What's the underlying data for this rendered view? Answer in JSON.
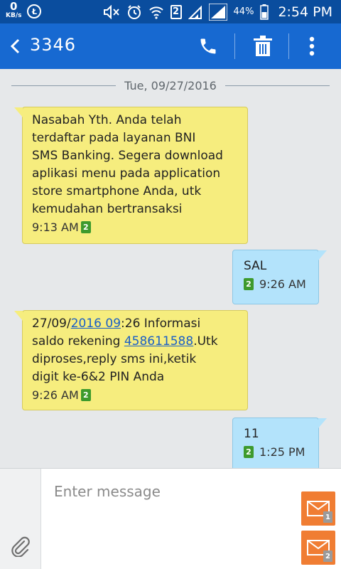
{
  "status_bar": {
    "speed_value": "0",
    "speed_unit": "KB/s",
    "coin_glyph": "Ł",
    "sim_number": "2",
    "battery_percent": "44%",
    "time": "2:54 PM",
    "icons": [
      "data-speed",
      "coin-icon",
      "mute-icon",
      "alarm-icon",
      "wifi-icon",
      "sim-2-icon",
      "signal-icon",
      "signal-icon",
      "battery-icon"
    ]
  },
  "app_bar": {
    "contact": "3346",
    "actions": [
      "call-icon",
      "delete-icon",
      "more-icon"
    ]
  },
  "conversation": {
    "date": "Tue, 09/27/2016",
    "messages": [
      {
        "type": "received",
        "text": "Nasabah Yth. Anda telah\nterdaftar pada layanan BNI\nSMS Banking. Segera download\naplikasi menu pada application\nstore smartphone Anda, utk\nkemudahan bertransaksi",
        "time": "9:13 AM",
        "sim": "2"
      },
      {
        "type": "sent",
        "text": "SAL",
        "time": "9:26 AM",
        "sim": "2"
      },
      {
        "type": "received",
        "text_parts": {
          "p1": "27/09/",
          "link1": "2016 09",
          "p2": ":26 Informasi\nsaldo rekening ",
          "link2": "458611588",
          "p3": ".Utk\ndiproses,reply sms ini,ketik\ndigit ke-6&2 PIN Anda"
        },
        "time": "9:26 AM",
        "sim": "2"
      },
      {
        "type": "sent",
        "text": "11",
        "time": "1:25 PM",
        "sim": "2"
      }
    ]
  },
  "composer": {
    "placeholder": "Enter message",
    "send_buttons": [
      {
        "sim": "1"
      },
      {
        "sim": "2"
      }
    ]
  },
  "colors": {
    "status_bar": "#0a4d9e",
    "app_bar": "#1769d1",
    "received_bubble": "#f6ed7e",
    "sent_bubble": "#b3e3fb",
    "send_button": "#f07d33",
    "sim_badge": "#3d9a2d"
  }
}
